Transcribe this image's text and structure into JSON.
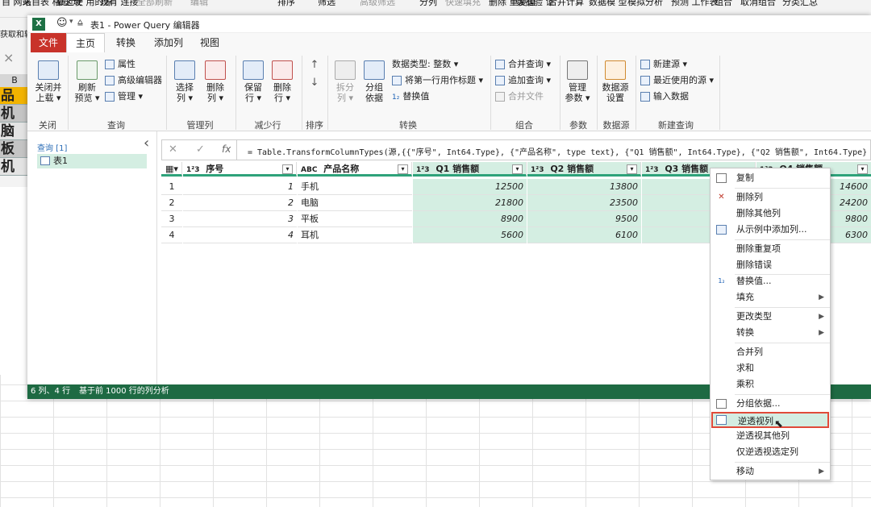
{
  "excel_bg": {
    "ribbon_items": [
      "自\n网站",
      "来自表\n格/区域",
      "最近使\n用的源",
      "现有\n连接",
      "全部刷新",
      "编辑",
      "排序",
      "筛选",
      "高级筛选",
      "分列",
      "快速填充",
      "删除\n重复值",
      "数据验\n证",
      "合并计算",
      "数据模\n型",
      "模拟分析",
      "预测\n工作表",
      "组合",
      "取消组合",
      "分类汇总"
    ],
    "side_text": "获取和转",
    "name_box_icon": "×",
    "col_b": "B",
    "cells": [
      "品名",
      "机",
      "脑",
      "板",
      "机"
    ]
  },
  "window": {
    "title": "表1 - Power Query 编辑器",
    "tabs": [
      "文件",
      "主页",
      "转换",
      "添加列",
      "视图"
    ]
  },
  "ribbon": {
    "groups": {
      "close": {
        "label": "关闭",
        "btn": "关闭并\n上载 ▾"
      },
      "query": {
        "label": "查询",
        "refresh": "刷新\n预览 ▾",
        "properties": "属性",
        "advanced_editor": "高级编辑器",
        "manage": "管理 ▾"
      },
      "manage_cols": {
        "label": "管理列",
        "choose": "选择\n列 ▾",
        "remove": "删除\n列 ▾"
      },
      "reduce_rows": {
        "label": "减少行",
        "keep": "保留\n行 ▾",
        "remove": "删除\n行 ▾"
      },
      "sort": {
        "label": "排序"
      },
      "transform": {
        "label": "转换",
        "split": "拆分\n列 ▾",
        "group": "分组\n依据",
        "datatype": "数据类型: 整数 ▾",
        "first_row_header": "将第一行用作标题 ▾",
        "replace": "替换值"
      },
      "combine": {
        "label": "组合",
        "merge": "合并查询 ▾",
        "append": "追加查询 ▾",
        "merge_files": "合并文件"
      },
      "params": {
        "label": "参数",
        "manage": "管理\n参数 ▾"
      },
      "datasource": {
        "label": "数据源",
        "settings": "数据源\n设置"
      },
      "new_query": {
        "label": "新建查询",
        "new_source": "新建源 ▾",
        "recent": "最近使用的源 ▾",
        "enter_data": "输入数据"
      }
    }
  },
  "left_pane": {
    "header": "查询 [1]",
    "collapse": "‹",
    "item": "表1"
  },
  "formula": {
    "cancel": "✕",
    "accept": "✓",
    "fx": "fx",
    "text": "= Table.TransformColumnTypes(源,{{\"序号\", Int64.Type}, {\"产品名称\", type text}, {\"Q1 销售额\", Int64.Type}, {\"Q2 销售额\", Int64.Type},"
  },
  "table": {
    "columns": [
      {
        "type": "1²3",
        "name": "序号"
      },
      {
        "type": "ABC",
        "name": "产品名称"
      },
      {
        "type": "1²3",
        "name": "Q1 销售额"
      },
      {
        "type": "1²3",
        "name": "Q2 销售额"
      },
      {
        "type": "1²3",
        "name": "Q3 销售额"
      },
      {
        "type": "1²3",
        "name": "Q4 销售额"
      }
    ],
    "rows": [
      {
        "n": "1",
        "id": "1",
        "name": "手机",
        "q1": "12500",
        "q2": "13800",
        "q4": "14600"
      },
      {
        "n": "2",
        "id": "2",
        "name": "电脑",
        "q1": "21800",
        "q2": "23500",
        "q4": "24200"
      },
      {
        "n": "3",
        "id": "3",
        "name": "平板",
        "q1": "8900",
        "q2": "9500",
        "q4": "9800"
      },
      {
        "n": "4",
        "id": "4",
        "name": "耳机",
        "q1": "5600",
        "q2": "6100",
        "q4": "6300"
      }
    ]
  },
  "status": {
    "left": "6 列、4 行",
    "right": "基于前 1000 行的列分析"
  },
  "context_menu": {
    "items": [
      "复制",
      "删除列",
      "删除其他列",
      "从示例中添加列...",
      "删除重复项",
      "删除错误",
      "替换值...",
      "填充",
      "更改类型",
      "转换",
      "合并列",
      "求和",
      "乘积",
      "分组依据...",
      "逆透视列",
      "逆透视其他列",
      "仅逆透视选定列",
      "移动"
    ]
  },
  "colors": {
    "accent_green": "#1e6a43",
    "file_tab_red": "#c8332a",
    "selected_col": "#d4eee2",
    "highlight_border": "#e04a3a"
  }
}
